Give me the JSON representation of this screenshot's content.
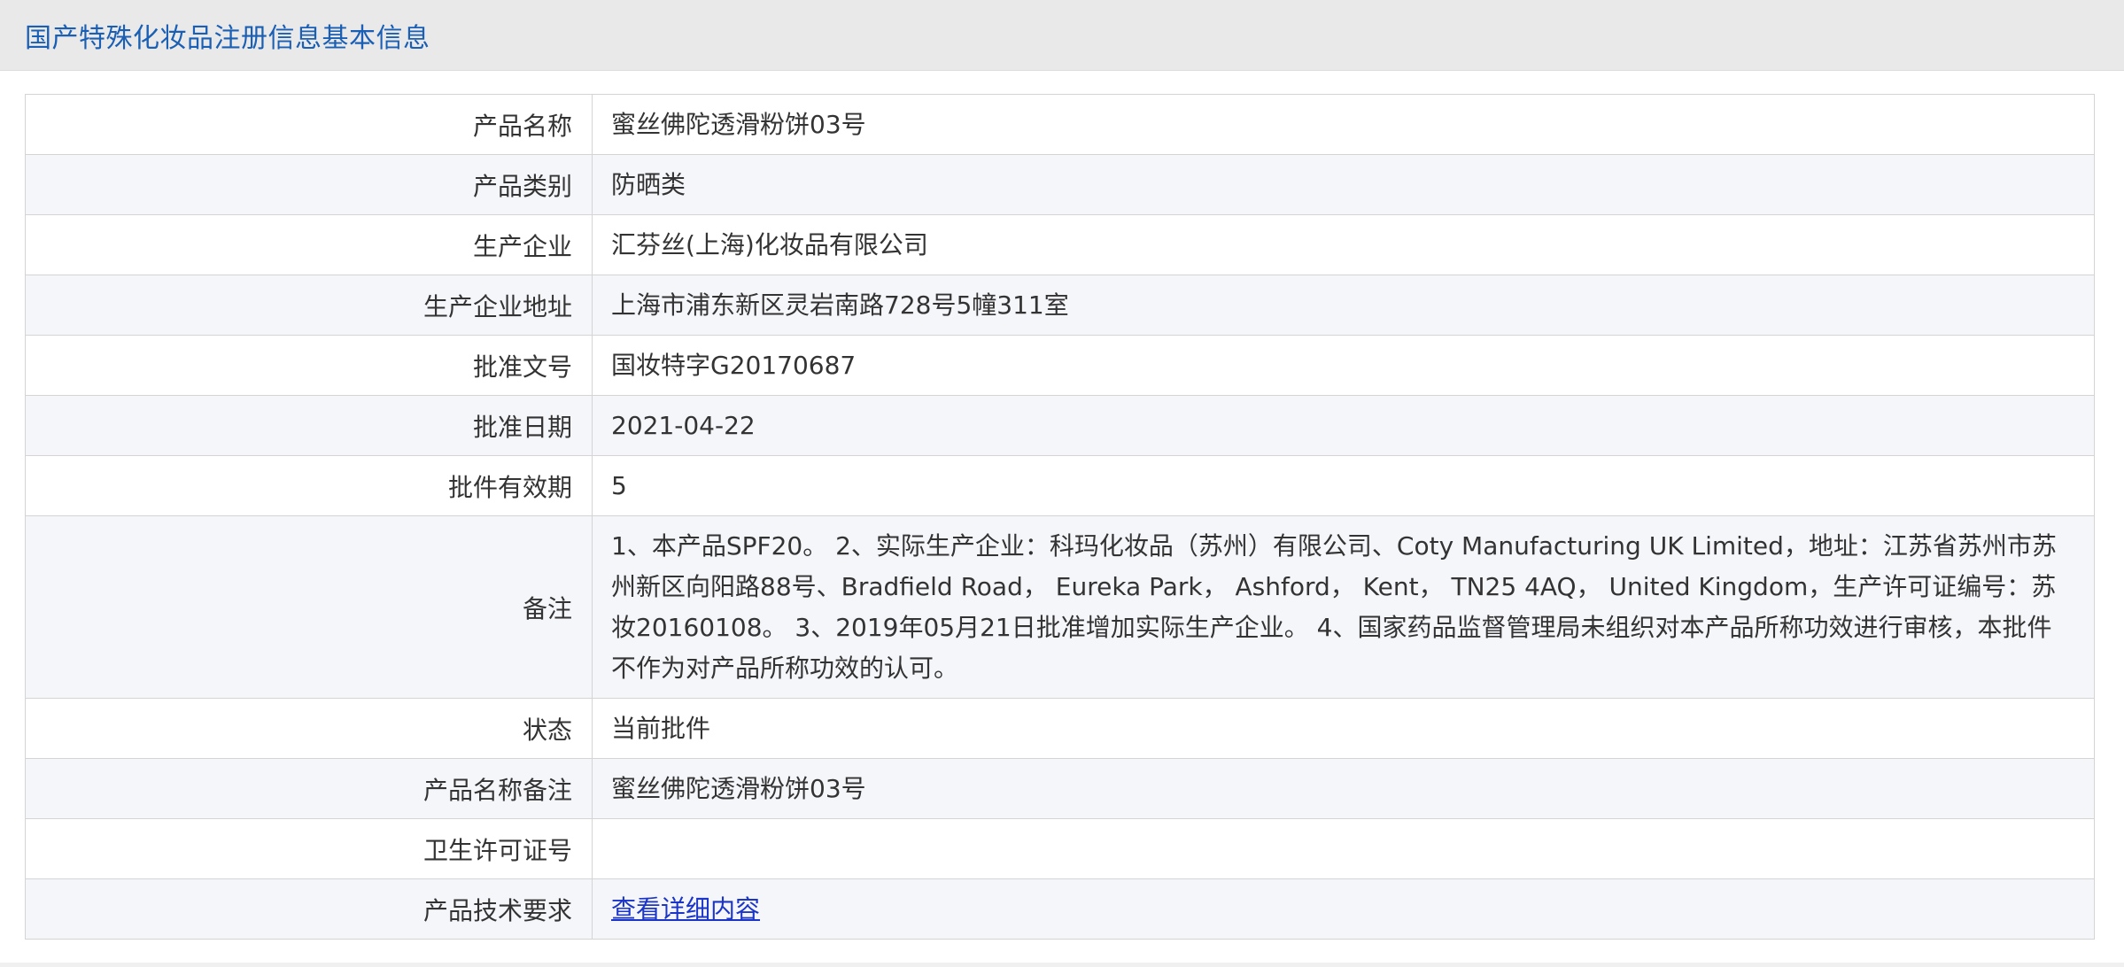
{
  "header": {
    "title": "国产特殊化妆品注册信息基本信息"
  },
  "rows": [
    {
      "label": "产品名称",
      "value": "蜜丝佛陀透滑粉饼03号"
    },
    {
      "label": "产品类别",
      "value": "防晒类"
    },
    {
      "label": "生产企业",
      "value": "汇芬丝(上海)化妆品有限公司"
    },
    {
      "label": "生产企业地址",
      "value": "上海市浦东新区灵岩南路728号5幢311室"
    },
    {
      "label": "批准文号",
      "value": "国妆特字G20170687"
    },
    {
      "label": "批准日期",
      "value": "2021-04-22"
    },
    {
      "label": "批件有效期",
      "value": "5"
    },
    {
      "label": "备注",
      "value": "1、本产品SPF20。 2、实际生产企业：科玛化妆品（苏州）有限公司、Coty Manufacturing UK Limited，地址：江苏省苏州市苏州新区向阳路88号、Bradfield Road， Eureka Park， Ashford， Kent， TN25 4AQ， United Kingdom，生产许可证编号：苏妆20160108。 3、2019年05月21日批准增加实际生产企业。 4、国家药品监督管理局未组织对本产品所称功效进行审核，本批件不作为对产品所称功效的认可。"
    },
    {
      "label": "状态",
      "value": "当前批件"
    },
    {
      "label": "产品名称备注",
      "value": "蜜丝佛陀透滑粉饼03号"
    },
    {
      "label": "卫生许可证号",
      "value": ""
    },
    {
      "label": "产品技术要求",
      "value": "查看详细内容"
    }
  ]
}
